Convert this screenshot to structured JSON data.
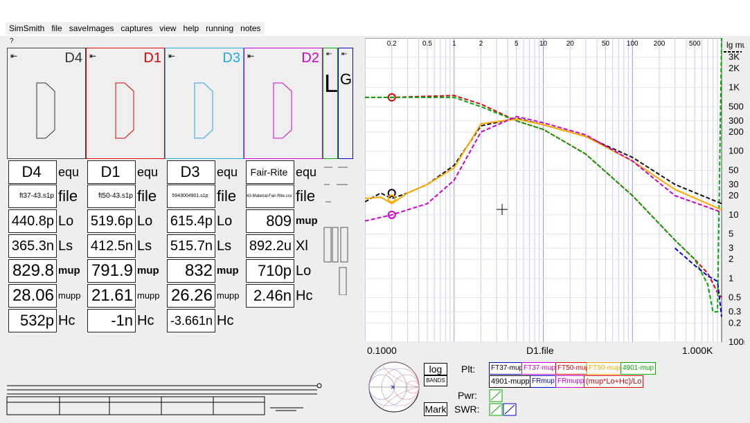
{
  "menu": [
    "SimSmith",
    "file",
    "saveImages",
    "captures",
    "view",
    "help",
    "running",
    "notes"
  ],
  "help_mark": "?",
  "panels": [
    {
      "name": "D4",
      "color": "#333333"
    },
    {
      "name": "D1",
      "color": "#dd0000"
    },
    {
      "name": "D3",
      "color": "#22aadd"
    },
    {
      "name": "D2",
      "color": "#cc00cc"
    }
  ],
  "mini_L": "L",
  "mini_G": "G",
  "arrow": "⇤",
  "columns": [
    {
      "title": "D4",
      "rows": [
        "ft37-43.s1p",
        "440.8p",
        "365.3n",
        "829.8",
        "28.06",
        "532p"
      ],
      "labels": [
        "equ",
        "file",
        "Lo",
        "Ls",
        "mup",
        "mupp",
        "Hc"
      ]
    },
    {
      "title": "D1",
      "rows": [
        "ft50-43.s1p",
        "519.6p",
        "412.5n",
        "791.9",
        "21.61",
        "-1n"
      ],
      "labels": [
        "equ",
        "file",
        "Lo",
        "Ls",
        "mup",
        "mupp",
        "Hc"
      ]
    },
    {
      "title": "D3",
      "rows": [
        "5943004901.s1p",
        "615.4p",
        "515.7n",
        "832",
        "26.26",
        "-3.661n"
      ],
      "labels": [
        "equ",
        "file",
        "Lo",
        "Ls",
        "mup",
        "mupp",
        "Hc"
      ]
    },
    {
      "title": "Fair-Rite",
      "rows": [
        "43-Material-Fair-Rite.csv",
        "809",
        "892.2u",
        "710p",
        "2.46n"
      ],
      "labels": [
        "equ",
        "file",
        "mup",
        "Xl",
        "Lo",
        "Hc"
      ]
    }
  ],
  "chart_data": {
    "type": "line",
    "xscale": "log",
    "yscale": "log",
    "xlim": [
      0.1,
      1000
    ],
    "ylim": [
      0.1,
      6000
    ],
    "top_ticks": [
      "0.2",
      "0.5",
      "1",
      "2",
      "5",
      "10",
      "20",
      "50",
      "100",
      "200",
      "500"
    ],
    "top_tick_values": [
      0.2,
      0.5,
      1,
      2,
      5,
      10,
      20,
      50,
      100,
      200,
      500
    ],
    "right_ticks": [
      "3K",
      "2K",
      "1K",
      "500",
      "300",
      "200",
      "100",
      "50",
      "30",
      "20",
      "10",
      "5",
      "3",
      "2",
      "1",
      "0.5",
      "0.3",
      "0.2",
      "100m"
    ],
    "right_tick_values": [
      3000,
      2000,
      1000,
      500,
      300,
      200,
      100,
      50,
      30,
      20,
      10,
      5,
      3,
      2,
      1,
      0.5,
      0.3,
      0.2,
      0.1
    ],
    "xlabel_left": "0.1000",
    "xlabel_mid": "D1.file",
    "xlabel_right": "1.000K",
    "ylabel": "lg mu",
    "series": [
      {
        "color": "#dd0000",
        "dash": true,
        "x": [
          0.1,
          0.2,
          1,
          2,
          5,
          10,
          30,
          100,
          300,
          500,
          700,
          900,
          1000
        ],
        "y": [
          700,
          700,
          750,
          550,
          300,
          220,
          90,
          20,
          4,
          2,
          1.2,
          0.6,
          0.5
        ]
      },
      {
        "color": "#00aa00",
        "dash": true,
        "x": [
          0.1,
          0.2,
          1,
          2,
          5,
          10,
          30,
          100,
          300,
          500,
          700,
          800,
          900,
          1000
        ],
        "y": [
          700,
          700,
          700,
          500,
          300,
          220,
          90,
          20,
          4,
          2,
          0.8,
          0.3,
          0.3,
          6000
        ]
      },
      {
        "color": "#111111",
        "dash": true,
        "x": [
          0.1,
          0.15,
          0.2,
          0.3,
          0.5,
          1,
          2,
          5,
          10,
          30,
          100,
          300,
          1000
        ],
        "y": [
          16,
          22,
          18,
          22,
          30,
          60,
          250,
          330,
          260,
          170,
          80,
          30,
          15
        ]
      },
      {
        "color": "#ffaa00",
        "dash": false,
        "x": [
          0.1,
          0.15,
          0.2,
          0.3,
          0.5,
          1,
          2,
          5,
          10,
          30,
          100,
          300,
          1000
        ],
        "y": [
          18,
          19,
          15,
          22,
          30,
          55,
          270,
          320,
          260,
          170,
          70,
          25,
          12
        ]
      },
      {
        "color": "#cc00cc",
        "dash": true,
        "x": [
          0.1,
          0.2,
          0.5,
          1,
          2,
          5,
          10,
          30,
          100,
          300,
          1000
        ],
        "y": [
          8,
          10,
          15,
          35,
          200,
          350,
          280,
          180,
          70,
          20,
          11
        ]
      },
      {
        "color": "#0000cc",
        "dash": true,
        "x": [
          300,
          500,
          700,
          900,
          1000
        ],
        "y": [
          3,
          1.6,
          1.1,
          0.9,
          0.25
        ]
      }
    ],
    "markers": [
      {
        "x": 0.2,
        "y": 700,
        "color": "#dd0000"
      },
      {
        "x": 0.2,
        "y": 22,
        "color": "#cc00cc"
      },
      {
        "x": 0.2,
        "y": 22,
        "color": "#111111"
      },
      {
        "x": 0.2,
        "y": 18,
        "color": "#ffaa00"
      },
      {
        "x": 0.2,
        "y": 10,
        "color": "#cc00cc"
      }
    ]
  },
  "controls": {
    "log_label": "log",
    "bands_label": "BANDS",
    "mark_label": "Mark",
    "plt_label": "Plt:",
    "pwr_label": "Pwr:",
    "swr_label": "SWR:",
    "legend": [
      {
        "label": "FT37-mup",
        "color": "#0000cc"
      },
      {
        "label": "FT37-mupp",
        "color": "#cc00cc"
      },
      {
        "label": "FT50-mup",
        "color": "#dd0000"
      },
      {
        "label": "FT50-mupp",
        "color": "#ffaa00"
      },
      {
        "label": "4901-mup",
        "color": "#00aa00"
      },
      {
        "label": "4901-mupp",
        "color": "#000000"
      },
      {
        "label": "FRmup",
        "color": "#0000cc"
      },
      {
        "label": "FRmupp",
        "color": "#cc00cc"
      },
      {
        "label": "(mup*Lo+Hc)/Lo",
        "color": "#dd0000"
      }
    ]
  }
}
